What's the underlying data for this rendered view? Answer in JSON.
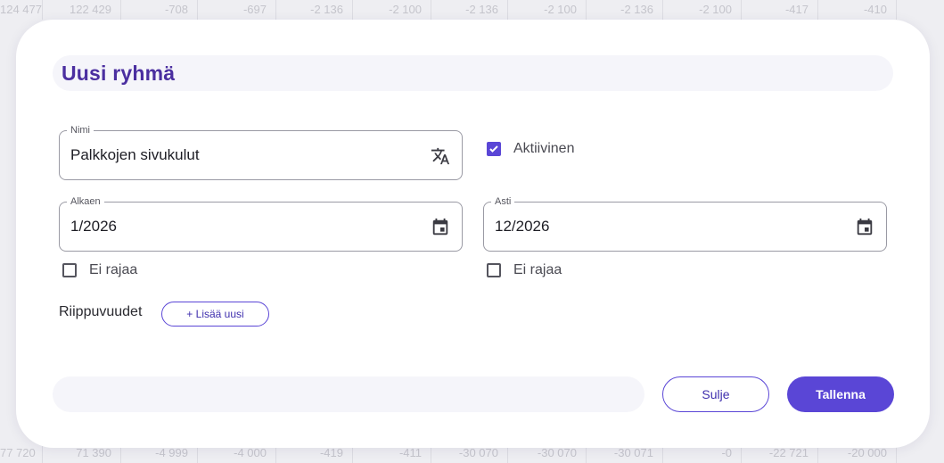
{
  "background_table": {
    "top_row": [
      "124 477",
      "122 429",
      "-708",
      "-697",
      "-2 136",
      "-2 100",
      "-2 136",
      "-2 100",
      "-2 136",
      "-2 100",
      "-417",
      "-410"
    ],
    "bottom_row": [
      "77 720",
      "71 390",
      "-4 999",
      "-4 000",
      "-419",
      "-411",
      "-30 070",
      "-30 070",
      "-30 071",
      "-0",
      "-22 721",
      "-20 000"
    ]
  },
  "dialog": {
    "title": "Uusi ryhmä",
    "name_field": {
      "label": "Nimi",
      "value": "Palkkojen sivukulut",
      "icon": "translate-icon"
    },
    "active": {
      "label": "Aktiivinen",
      "checked": true
    },
    "from_field": {
      "label": "Alkaen",
      "value": "1/2026",
      "icon": "calendar-icon"
    },
    "to_field": {
      "label": "Asti",
      "value": "12/2026",
      "icon": "calendar-icon"
    },
    "from_no_limit": {
      "label": "Ei rajaa",
      "checked": false
    },
    "to_no_limit": {
      "label": "Ei rajaa",
      "checked": false
    },
    "dependencies": {
      "label": "Riippuvuudet",
      "add_button": "+ Lisää uusi"
    },
    "footer": {
      "close_button": "Sulje",
      "save_button": "Tallenna"
    }
  },
  "colors": {
    "accent": "#5a46d6",
    "title": "#4b2fa0",
    "panel": "#f5f5fa"
  }
}
